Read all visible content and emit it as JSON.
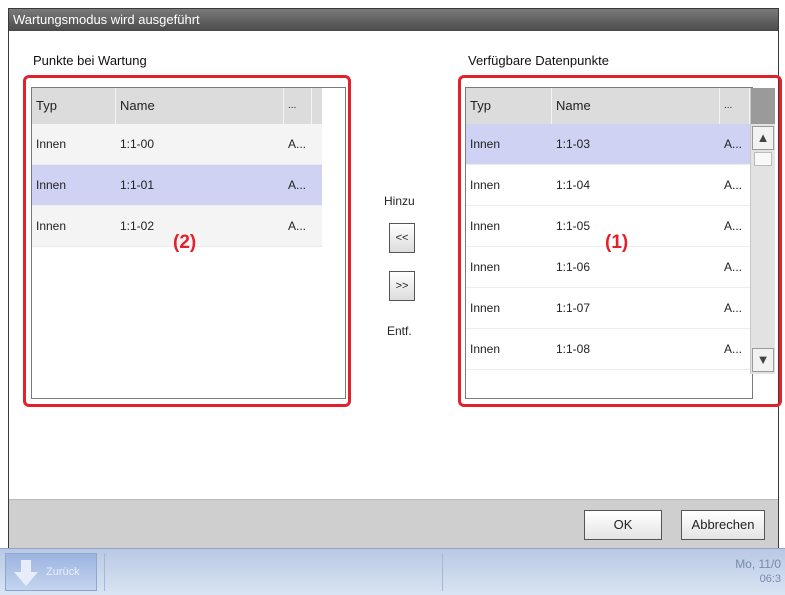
{
  "dialog": {
    "title": "Wartungsmodus wird ausgeführt",
    "left_panel": {
      "label": "Punkte bei Wartung",
      "columns": [
        "Typ",
        "Name",
        "..."
      ],
      "rows": [
        {
          "typ": "Innen",
          "name": "1:1-00",
          "more": "A..."
        },
        {
          "typ": "Innen",
          "name": "1:1-01",
          "more": "A..."
        },
        {
          "typ": "Innen",
          "name": "1:1-02",
          "more": "A..."
        }
      ],
      "callout": "(2)"
    },
    "right_panel": {
      "label": "Verfügbare Datenpunkte",
      "columns": [
        "Typ",
        "Name",
        "..."
      ],
      "rows": [
        {
          "typ": "Innen",
          "name": "1:1-03",
          "more": "A..."
        },
        {
          "typ": "Innen",
          "name": "1:1-04",
          "more": "A..."
        },
        {
          "typ": "Innen",
          "name": "1:1-05",
          "more": "A..."
        },
        {
          "typ": "Innen",
          "name": "1:1-06",
          "more": "A..."
        },
        {
          "typ": "Innen",
          "name": "1:1-07",
          "more": "A..."
        },
        {
          "typ": "Innen",
          "name": "1:1-08",
          "more": "A..."
        }
      ],
      "callout": "(1)"
    },
    "middle": {
      "add_label": "Hinzu",
      "add_button": "<<",
      "remove_button": ">>",
      "remove_label": "Entf."
    },
    "buttons": {
      "ok": "OK",
      "cancel": "Abbrechen"
    }
  },
  "taskbar": {
    "start_label": "Zurück",
    "date": "Mo, 11/0",
    "time": "06:3"
  },
  "colors": {
    "selection": "#cfd2f2",
    "callout_red": "#e1222c",
    "titlebar": "#4a4a4a",
    "taskbar": "#c4d4ef"
  },
  "icons": {
    "scroll_up": "triangle-up-icon",
    "scroll_down": "triangle-down-icon",
    "taskbar_start": "arrow-down-icon"
  }
}
